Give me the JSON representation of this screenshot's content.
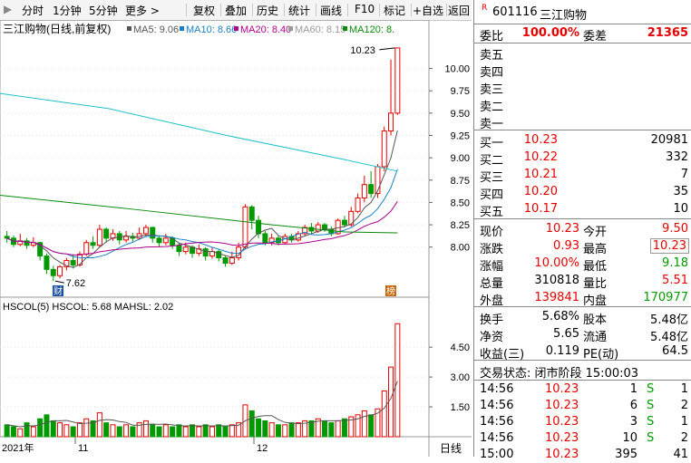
{
  "toolbar": {
    "items": [
      "分时",
      "1分钟",
      "5分钟",
      "更多 >",
      "复权",
      "叠加",
      "历史",
      "统计",
      "画线",
      "F10",
      "标记",
      "+自选",
      "返回"
    ]
  },
  "kline_panel": {
    "title": "三江购物(日线,前复权)",
    "ma_labels": [
      {
        "text": "MA5: 9.06",
        "color": "#555555"
      },
      {
        "text": "MA10: 8.66",
        "color": "#1a7fc8"
      },
      {
        "text": "MA20: 8.40",
        "color": "#b0008c"
      },
      {
        "text": "MA60: 8.15",
        "color": "#9a9a9a"
      },
      {
        "text": "MA120: 8.",
        "color": "#0b8a0b"
      }
    ],
    "price_ticks": [
      "10.00",
      "9.75",
      "9.50",
      "9.25",
      "9.00",
      "8.75",
      "8.50",
      "8.25",
      "8.00"
    ],
    "max_label": "10.23",
    "min_label": "7.62",
    "marker_left": "财",
    "marker_right": "榜"
  },
  "volume_panel": {
    "title": "HSCOL(5)  HSCOL: 5.68  MAHSL: 2.02",
    "ticks": [
      "4.50",
      "3.00",
      "1.50"
    ]
  },
  "xaxis": {
    "labels": [
      "2021年",
      "11",
      "12"
    ],
    "period": "日线"
  },
  "chart_data": {
    "type": "candlestick",
    "ylim": [
      7.5,
      10.3
    ],
    "candles": [
      [
        8.12,
        8.1,
        8.18,
        8.05
      ],
      [
        8.1,
        8.03,
        8.13,
        8.0
      ],
      [
        8.03,
        8.07,
        8.15,
        8.01
      ],
      [
        8.07,
        8.02,
        8.1,
        7.98
      ],
      [
        8.02,
        8.05,
        8.11,
        8.0
      ],
      [
        8.05,
        7.9,
        8.06,
        7.85
      ],
      [
        7.9,
        7.75,
        7.93,
        7.7
      ],
      [
        7.75,
        7.68,
        7.79,
        7.62
      ],
      [
        7.68,
        7.78,
        7.8,
        7.65
      ],
      [
        7.78,
        7.85,
        7.88,
        7.74
      ],
      [
        7.85,
        7.8,
        7.92,
        7.76
      ],
      [
        7.8,
        7.92,
        7.95,
        7.78
      ],
      [
        7.92,
        8.05,
        8.08,
        7.9
      ],
      [
        8.05,
        8.02,
        8.12,
        7.98
      ],
      [
        8.02,
        8.2,
        8.25,
        8.0
      ],
      [
        8.2,
        8.1,
        8.22,
        8.05
      ],
      [
        8.1,
        8.15,
        8.2,
        8.07
      ],
      [
        8.15,
        8.08,
        8.18,
        8.03
      ],
      [
        8.08,
        8.12,
        8.18,
        8.05
      ],
      [
        8.12,
        8.1,
        8.16,
        8.06
      ],
      [
        8.1,
        8.15,
        8.22,
        8.08
      ],
      [
        8.15,
        8.22,
        8.25,
        8.12
      ],
      [
        8.22,
        8.1,
        8.23,
        8.05
      ],
      [
        8.1,
        8.05,
        8.12,
        8.0
      ],
      [
        8.05,
        8.1,
        8.15,
        8.02
      ],
      [
        8.1,
        8.02,
        8.12,
        7.98
      ],
      [
        8.02,
        7.95,
        8.05,
        7.9
      ],
      [
        7.95,
        8.0,
        8.05,
        7.92
      ],
      [
        8.0,
        7.93,
        8.02,
        7.88
      ],
      [
        7.93,
        7.98,
        8.03,
        7.9
      ],
      [
        7.98,
        7.9,
        8.0,
        7.85
      ],
      [
        7.9,
        7.95,
        8.0,
        7.87
      ],
      [
        7.95,
        7.88,
        7.98,
        7.84
      ],
      [
        7.88,
        7.82,
        7.9,
        7.78
      ],
      [
        7.82,
        7.88,
        7.95,
        7.8
      ],
      [
        7.88,
        8.0,
        8.05,
        7.85
      ],
      [
        8.0,
        8.45,
        8.48,
        7.98
      ],
      [
        8.45,
        8.3,
        8.47,
        8.2
      ],
      [
        8.3,
        8.15,
        8.35,
        8.1
      ],
      [
        8.15,
        8.05,
        8.18,
        8.02
      ],
      [
        8.05,
        8.1,
        8.15,
        8.02
      ],
      [
        8.1,
        8.05,
        8.13,
        8.02
      ],
      [
        8.05,
        8.12,
        8.15,
        8.03
      ],
      [
        8.12,
        8.08,
        8.15,
        8.05
      ],
      [
        8.08,
        8.15,
        8.18,
        8.06
      ],
      [
        8.15,
        8.22,
        8.25,
        8.12
      ],
      [
        8.22,
        8.18,
        8.27,
        8.15
      ],
      [
        8.18,
        8.25,
        8.28,
        8.16
      ],
      [
        8.25,
        8.2,
        8.27,
        8.17
      ],
      [
        8.2,
        8.15,
        8.23,
        8.12
      ],
      [
        8.15,
        8.3,
        8.32,
        8.14
      ],
      [
        8.3,
        8.25,
        8.35,
        8.22
      ],
      [
        8.25,
        8.4,
        8.45,
        8.23
      ],
      [
        8.4,
        8.55,
        8.6,
        8.38
      ],
      [
        8.55,
        8.7,
        8.8,
        8.5
      ],
      [
        8.7,
        8.6,
        8.85,
        8.55
      ],
      [
        8.6,
        8.9,
        8.93,
        8.55
      ],
      [
        8.9,
        9.3,
        9.35,
        8.85
      ],
      [
        9.3,
        9.5,
        10.1,
        9.25
      ],
      [
        9.5,
        10.23,
        10.23,
        9.48
      ]
    ],
    "volume": [
      0.6,
      0.5,
      0.4,
      0.7,
      0.5,
      0.9,
      1.1,
      0.8,
      0.7,
      0.6,
      0.5,
      0.7,
      0.9,
      0.8,
      1.2,
      0.7,
      0.6,
      0.5,
      0.6,
      0.5,
      0.7,
      0.8,
      0.6,
      0.5,
      0.6,
      0.5,
      0.6,
      0.5,
      0.6,
      0.5,
      0.6,
      0.5,
      0.6,
      0.5,
      0.6,
      0.7,
      1.6,
      1.3,
      0.9,
      0.8,
      0.7,
      0.6,
      0.6,
      0.7,
      0.7,
      0.8,
      0.8,
      0.9,
      0.8,
      0.7,
      0.8,
      0.9,
      1.0,
      1.1,
      1.3,
      1.1,
      1.4,
      2.3,
      3.5,
      5.68
    ]
  },
  "quote": {
    "code": "601116",
    "name": "三江购物",
    "r_badge": "R",
    "weibi_label": "委比",
    "weibi_value": "100.00%",
    "weicha_label": "委差",
    "weicha_value": "21365",
    "sell": [
      {
        "label": "卖五",
        "price": "",
        "vol": ""
      },
      {
        "label": "卖四",
        "price": "",
        "vol": ""
      },
      {
        "label": "卖三",
        "price": "",
        "vol": ""
      },
      {
        "label": "卖二",
        "price": "",
        "vol": ""
      },
      {
        "label": "卖一",
        "price": "",
        "vol": ""
      }
    ],
    "buy": [
      {
        "label": "买一",
        "price": "10.23",
        "vol": "20981"
      },
      {
        "label": "买二",
        "price": "10.22",
        "vol": "332"
      },
      {
        "label": "买三",
        "price": "10.21",
        "vol": "7"
      },
      {
        "label": "买四",
        "price": "10.20",
        "vol": "35"
      },
      {
        "label": "买五",
        "price": "10.17",
        "vol": "10"
      }
    ],
    "stats": [
      {
        "l1": "现价",
        "v1": "10.23",
        "c1": "red",
        "l2": "今开",
        "v2": "9.50",
        "c2": "red"
      },
      {
        "l1": "涨跌",
        "v1": "0.93",
        "c1": "red",
        "l2": "最高",
        "v2": "10.23",
        "c2": "red"
      },
      {
        "l1": "涨幅",
        "v1": "10.00%",
        "c1": "red",
        "l2": "最低",
        "v2": "9.18",
        "c2": "grn"
      },
      {
        "l1": "总量",
        "v1": "310818",
        "c1": "blk",
        "l2": "量比",
        "v2": "5.51",
        "c2": "red"
      },
      {
        "l1": "外盘",
        "v1": "139841",
        "c1": "red",
        "l2": "内盘",
        "v2": "170977",
        "c2": "grn"
      }
    ],
    "fund": [
      {
        "l1": "换手",
        "v1": "5.68%",
        "l2": "股本",
        "v2": "5.48亿"
      },
      {
        "l1": "净资",
        "v1": "5.65",
        "l2": "流通",
        "v2": "5.48亿"
      },
      {
        "l1": "收益(三)",
        "v1": "0.119",
        "l2": "PE(动)",
        "v2": "64.5"
      }
    ],
    "status": "交易状态: 闭市阶段 15:00:03",
    "ticks": [
      {
        "time": "14:56",
        "price": "10.23",
        "vol": "1",
        "bs": "S",
        "n": "1"
      },
      {
        "time": "14:56",
        "price": "10.23",
        "vol": "6",
        "bs": "S",
        "n": "2"
      },
      {
        "time": "14:56",
        "price": "10.23",
        "vol": "3",
        "bs": "S",
        "n": "1"
      },
      {
        "time": "14:56",
        "price": "10.23",
        "vol": "10",
        "bs": "S",
        "n": "2"
      },
      {
        "time": "15:00",
        "price": "10.23",
        "vol": "395",
        "bs": "",
        "n": "41"
      }
    ]
  }
}
